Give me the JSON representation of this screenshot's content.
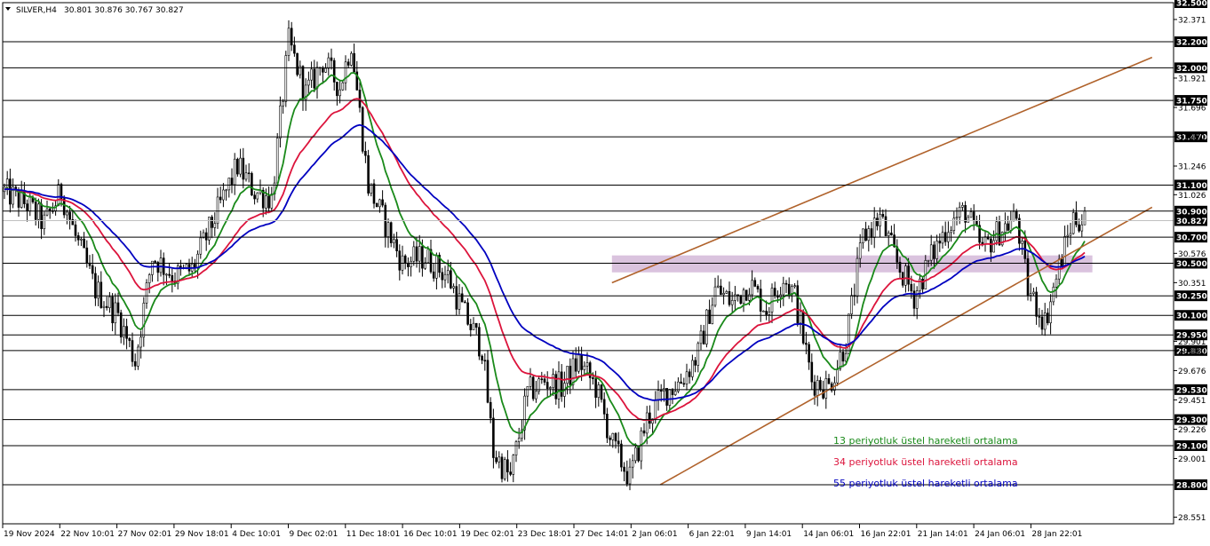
{
  "header": {
    "symbol": "SILVER,H4",
    "ohlc": "30.801 30.876 30.767 30.827"
  },
  "legend": [
    {
      "label": "13 periyotluk üstel hareketli ortalama",
      "color": "#1a8a1a"
    },
    {
      "label": "34 periyotluk üstel hareketli ortalama",
      "color": "#dc143c"
    },
    {
      "label": "55 periyotluk üstel hareketli ortalama",
      "color": "#0000c0"
    }
  ],
  "chart_data": {
    "type": "candlestick",
    "ylim": [
      28.5,
      32.5
    ],
    "y_ticks": [
      "31.696",
      "31.246",
      "31.026",
      "30.576",
      "30.351",
      "29.676",
      "29.451",
      "29.226",
      "29.001",
      "28.551"
    ],
    "y_tick_values": [
      31.696,
      31.246,
      31.026,
      30.576,
      30.351,
      29.676,
      29.451,
      29.226,
      29.001,
      28.551
    ],
    "minor_ticks": [
      "32.371",
      "31.921",
      "31.471",
      "29.901",
      "29.830"
    ],
    "minor_tick_values": [
      32.371,
      31.921,
      31.471,
      29.901,
      29.83
    ],
    "levels": [
      "32.500",
      "32.200",
      "32.000",
      "31.750",
      "31.470",
      "31.100",
      "30.900",
      "30.827",
      "30.700",
      "30.500",
      "30.250",
      "30.100",
      "29.950",
      "29.830",
      "29.530",
      "29.300",
      "29.100",
      "28.800"
    ],
    "level_values": [
      32.5,
      32.2,
      32.0,
      31.75,
      31.47,
      31.1,
      30.9,
      30.827,
      30.7,
      30.5,
      30.25,
      30.1,
      29.95,
      29.83,
      29.53,
      29.3,
      29.1,
      28.8
    ],
    "current_price": "30.827",
    "x_labels": [
      "19 Nov 2024",
      "22 Nov 10:01",
      "27 Nov 02:01",
      "29 Nov 18:01",
      "4 Dec 10:01",
      "9 Dec 02:01",
      "11 Dec 18:01",
      "16 Dec 10:01",
      "19 Dec 02:01",
      "23 Dec 18:01",
      "27 Dec 14:01",
      "2 Jan 06:01",
      "6 Jan 22:01",
      "9 Jan 14:01",
      "14 Jan 06:01",
      "16 Jan 22:01",
      "21 Jan 14:01",
      "24 Jan 06:01",
      "28 Jan 22:01"
    ],
    "anchors": [
      [
        0,
        31.05
      ],
      [
        8,
        30.95
      ],
      [
        14,
        30.8
      ],
      [
        20,
        31.05
      ],
      [
        25,
        30.7
      ],
      [
        32,
        30.3
      ],
      [
        40,
        30.1
      ],
      [
        46,
        29.75
      ],
      [
        52,
        30.55
      ],
      [
        60,
        30.4
      ],
      [
        66,
        30.45
      ],
      [
        74,
        30.85
      ],
      [
        82,
        31.25
      ],
      [
        88,
        31.05
      ],
      [
        94,
        31.0
      ],
      [
        100,
        32.2
      ],
      [
        106,
        31.8
      ],
      [
        112,
        32.05
      ],
      [
        118,
        31.85
      ],
      [
        122,
        32.2
      ],
      [
        128,
        31.1
      ],
      [
        134,
        30.8
      ],
      [
        140,
        30.5
      ],
      [
        148,
        30.55
      ],
      [
        156,
        30.4
      ],
      [
        162,
        30.1
      ],
      [
        168,
        29.85
      ],
      [
        172,
        29.05
      ],
      [
        178,
        28.85
      ],
      [
        184,
        29.5
      ],
      [
        190,
        29.6
      ],
      [
        196,
        29.55
      ],
      [
        202,
        29.75
      ],
      [
        208,
        29.55
      ],
      [
        214,
        29.1
      ],
      [
        220,
        28.85
      ],
      [
        226,
        29.3
      ],
      [
        232,
        29.5
      ],
      [
        238,
        29.6
      ],
      [
        244,
        29.8
      ],
      [
        250,
        30.3
      ],
      [
        256,
        30.2
      ],
      [
        262,
        30.35
      ],
      [
        268,
        30.15
      ],
      [
        274,
        30.4
      ],
      [
        278,
        30.25
      ],
      [
        284,
        29.6
      ],
      [
        290,
        29.55
      ],
      [
        296,
        29.9
      ],
      [
        302,
        30.7
      ],
      [
        308,
        30.85
      ],
      [
        314,
        30.5
      ],
      [
        320,
        30.25
      ],
      [
        326,
        30.55
      ],
      [
        332,
        30.8
      ],
      [
        338,
        30.9
      ],
      [
        344,
        30.6
      ],
      [
        350,
        30.75
      ],
      [
        356,
        30.85
      ],
      [
        360,
        30.3
      ],
      [
        366,
        30.05
      ],
      [
        372,
        30.55
      ],
      [
        376,
        30.85
      ],
      [
        380,
        30.83
      ]
    ],
    "ema_series": [
      {
        "period": 13,
        "color": "#1a8a1a"
      },
      {
        "period": 34,
        "color": "#dc143c"
      },
      {
        "period": 55,
        "color": "#0000c0"
      }
    ],
    "channel": {
      "lower": {
        "start": [
          231,
          28.8
        ],
        "end": [
          404,
          30.93
        ]
      },
      "upper": {
        "start": [
          214,
          30.35
        ],
        "end": [
          404,
          32.08
        ]
      },
      "color": "#b0622b"
    },
    "zone": {
      "from_bar": 214,
      "to_bar": 383,
      "low": 30.43,
      "high": 30.56,
      "color": "#d4b8d8"
    }
  }
}
